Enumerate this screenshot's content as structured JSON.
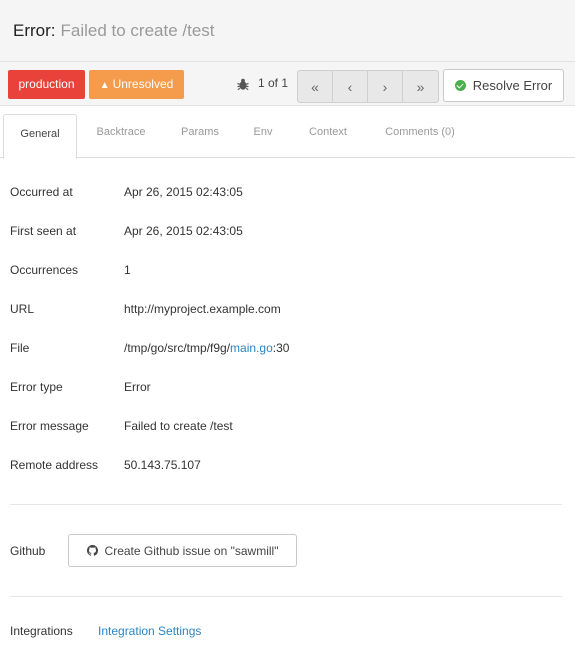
{
  "header": {
    "title_prefix": "Error:",
    "title_detail": "Failed to create /test"
  },
  "toolbar": {
    "environment_label": "production",
    "status_label": "Unresolved",
    "pager_text": "1 of 1",
    "resolve_label": "Resolve Error",
    "pager_buttons": [
      "first-page",
      "previous-page",
      "next-page",
      "last-page"
    ]
  },
  "tabs": [
    {
      "label": "General",
      "active": true
    },
    {
      "label": "Backtrace",
      "active": false
    },
    {
      "label": "Params",
      "active": false
    },
    {
      "label": "Env",
      "active": false
    },
    {
      "label": "Context",
      "active": false
    },
    {
      "label": "Comments (0)",
      "active": false
    }
  ],
  "details": {
    "occurred_at": {
      "label": "Occurred at",
      "value": "Apr 26, 2015 02:43:05"
    },
    "first_seen_at": {
      "label": "First seen at",
      "value": "Apr 26, 2015 02:43:05"
    },
    "occurrences": {
      "label": "Occurrences",
      "value": "1"
    },
    "url": {
      "label": "URL",
      "value": "http://myproject.example.com"
    },
    "file": {
      "label": "File",
      "path_prefix": "/tmp/go/src/tmp/f9g/",
      "file_link": "main.go",
      "line_suffix": ":30"
    },
    "error_type": {
      "label": "Error type",
      "value": "Error"
    },
    "error_message": {
      "label": "Error message",
      "value": "Failed to create /test"
    },
    "remote_address": {
      "label": "Remote address",
      "value": "50.143.75.107"
    }
  },
  "github": {
    "label": "Github",
    "button_label": "Create Github issue on \"sawmill\""
  },
  "integrations": {
    "label": "Integrations",
    "link_label": "Integration Settings"
  },
  "colors": {
    "production": "#e8423a",
    "unresolved": "#f49b4c",
    "link": "#2a86c3",
    "resolve_check": "#4cae4c"
  },
  "icons": [
    "bug-icon",
    "warning-icon",
    "double-chevron-left-icon",
    "chevron-left-icon",
    "chevron-right-icon",
    "double-chevron-right-icon",
    "check-circle-icon",
    "github-icon"
  ]
}
